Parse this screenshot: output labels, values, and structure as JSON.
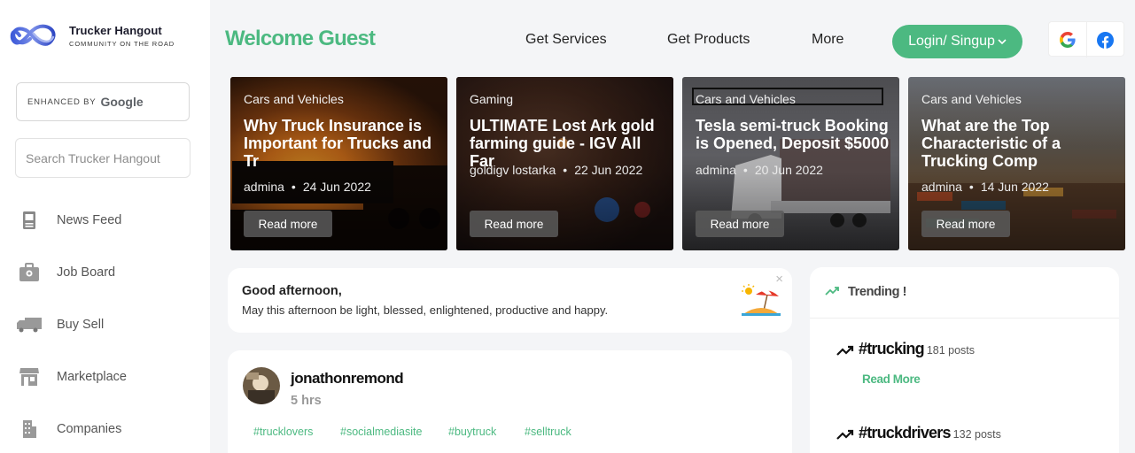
{
  "brand": {
    "name": "Trucker Hangout",
    "tagline": "COMMUNITY ON THE ROAD"
  },
  "sidebar": {
    "google_search": {
      "enhanced": "ENHANCED BY",
      "google": "Google"
    },
    "search": {
      "placeholder": "Search Trucker Hangout"
    },
    "items": [
      {
        "label": "News Feed",
        "icon": "news-feed-icon"
      },
      {
        "label": "Job Board",
        "icon": "job-board-icon"
      },
      {
        "label": "Buy Sell",
        "icon": "truck-icon"
      },
      {
        "label": "Marketplace",
        "icon": "store-icon"
      },
      {
        "label": "Companies",
        "icon": "building-icon"
      }
    ]
  },
  "header": {
    "welcome": "Welcome Guest",
    "nav": [
      "Get Services",
      "Get Products",
      "More"
    ],
    "login": "Login/ Singup"
  },
  "cards": [
    {
      "category": "Cars and Vehicles",
      "title": "Why Truck Insurance is Important for Trucks and Tr",
      "author": "admina",
      "date": "24 Jun 2022",
      "read_more": "Read more"
    },
    {
      "category": "Gaming",
      "title": "ULTIMATE Lost Ark gold farming guide - IGV All Far",
      "author": "goldigv lostarka",
      "date": "22 Jun 2022",
      "read_more": "Read more"
    },
    {
      "category": "Cars and Vehicles",
      "title": "Tesla semi-truck Booking is Opened, Deposit $5000",
      "author": "admina",
      "date": "20 Jun 2022",
      "read_more": "Read more"
    },
    {
      "category": "Cars and Vehicles",
      "title": "What are the Top Characteristic of a Trucking Comp",
      "author": "admina",
      "date": "14 Jun 2022",
      "read_more": "Read more"
    }
  ],
  "greeting": {
    "title": "Good afternoon,",
    "message": "May this afternoon be light, blessed, enlightened, productive and happy.",
    "close": "×"
  },
  "post": {
    "username": "jonathonremond",
    "time": "5 hrs",
    "tags": [
      "#trucklovers",
      "#socialmediasite",
      "#buytruck",
      "#selltruck"
    ]
  },
  "trending": {
    "title": "Trending !",
    "items": [
      {
        "tag": "#trucking",
        "count": "181 posts",
        "read_more": "Read More"
      },
      {
        "tag": "#truckdrivers",
        "count": "132 posts"
      }
    ]
  },
  "colors": {
    "accent": "#4cb981",
    "sidebar_bg": "#ffffff",
    "page_bg": "#f4f5f7"
  }
}
